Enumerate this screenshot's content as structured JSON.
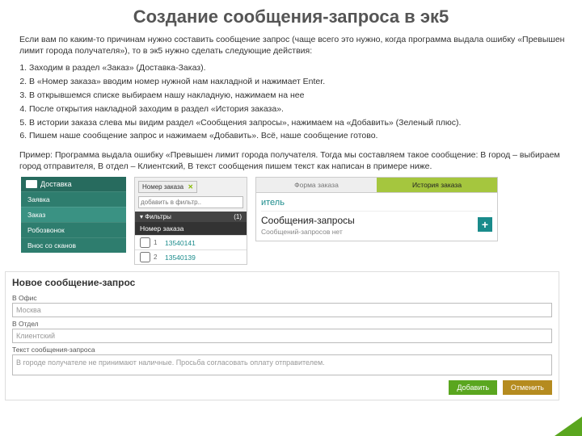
{
  "title": "Создание сообщения-запроса в эк5",
  "intro": "Если вам по каким-то причинам нужно составить сообщение запрос (чаще всего это нужно, когда программа выдала ошибку «Превышен лимит города получателя»), то в эк5 нужно сделать следующие действия:",
  "steps": [
    "Заходим в раздел «Заказ» (Доставка-Заказ).",
    "В «Номер заказа» вводим номер нужной нам накладной и нажимает Enter.",
    "В открывшемся списке выбираем нашу накладную, нажимаем на нее",
    "После открытия накладной заходим в раздел «История заказа».",
    "В истории заказа слева мы видим раздел «Сообщения запросы», нажимаем на «Добавить» (Зеленый плюс).",
    "Пишем наше сообщение запрос и нажимаем «Добавить». Всё, наше сообщение готово."
  ],
  "example": "Пример: Программа выдала ошибку «Превышен лимит города получателя. Тогда мы составляем такое сообщение: В город – выбираем город отправителя, В отдел – Клиентский, В текст сообщения пишем текст как написан в примере ниже.",
  "s1": {
    "header": "Доставка",
    "items": [
      "Заявка",
      "Заказ",
      "Робозвонок",
      "Внос со сканов"
    ]
  },
  "s2": {
    "tag": "Номер заказа",
    "placeholder": "добавить в фильтр..",
    "filters_label": "Фильтры",
    "filters_count": "(1)",
    "col": "Номер заказа",
    "rows": [
      {
        "n": "1",
        "id": "13540141"
      },
      {
        "n": "2",
        "id": "13540139"
      }
    ]
  },
  "s3": {
    "tab1": "Форма заказа",
    "tab2": "История заказа",
    "crumb": "итель",
    "head": "Сообщения-запросы",
    "sub": "Сообщений-запросов нет",
    "plus": "+"
  },
  "form": {
    "head": "Новое сообщение-запрос",
    "l_office": "В Офис",
    "v_office": "Москва",
    "l_dept": "В Отдел",
    "v_dept": "Клиентский",
    "l_text": "Текст сообщения-запроса",
    "v_text": "В городе получателе не принимают наличные. Просьба согласовать оплату отправителем.",
    "btn_add": "Добавить",
    "btn_cancel": "Отменить"
  }
}
